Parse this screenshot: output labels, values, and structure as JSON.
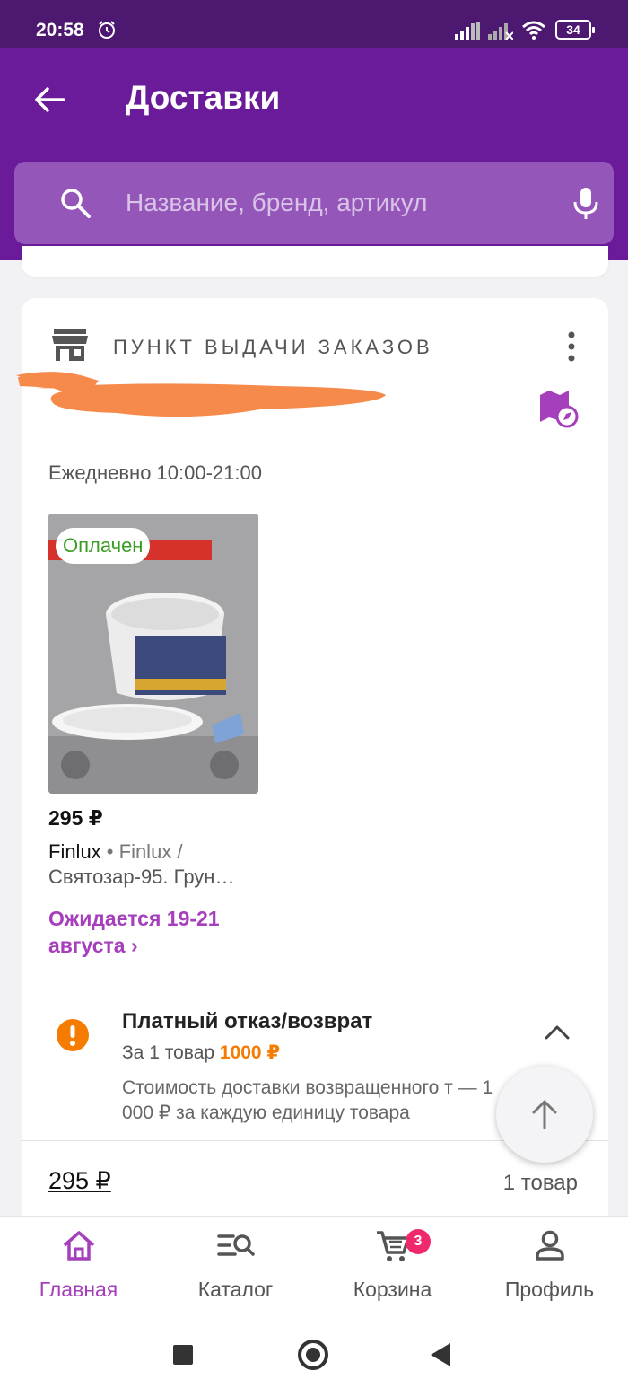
{
  "status_bar": {
    "time": "20:58",
    "battery": "34"
  },
  "header": {
    "title": "Доставки"
  },
  "search": {
    "placeholder": "Название, бренд, артикул"
  },
  "pickup": {
    "label": "ПУНКТ ВЫДАЧИ ЗАКАЗОВ",
    "hours": "Ежедневно 10:00-21:00"
  },
  "product": {
    "status_badge": "Оплачен",
    "price": "295 ₽",
    "brand": "Finlux",
    "brand_separator": " • ",
    "brand_sub": "Finlux /",
    "name": "Святозар-95. Грун…",
    "expected": "Ожидается 19-21 августа ›"
  },
  "refund": {
    "title": "Платный отказ/возврат",
    "prefix": "За 1 товар ",
    "amount": "1000 ₽",
    "note": "Стоимость доставки возвращенного т — 1 000 ₽ за каждую единицу товара"
  },
  "totals": {
    "total": "295 ₽",
    "count": "1 товар"
  },
  "bottom_nav": {
    "items": [
      {
        "label": "Главная",
        "icon": "home-icon",
        "active": true
      },
      {
        "label": "Каталог",
        "icon": "catalog-search-icon",
        "active": false
      },
      {
        "label": "Корзина",
        "icon": "cart-icon",
        "active": false,
        "badge": "3"
      },
      {
        "label": "Профиль",
        "icon": "profile-icon",
        "active": false
      }
    ]
  },
  "colors": {
    "header": "#6a1b9a",
    "statusbar": "#4c1870",
    "accent": "#a63fbb",
    "paid": "#3a9d23",
    "warning": "#f57c00",
    "badge": "#f0286e"
  }
}
